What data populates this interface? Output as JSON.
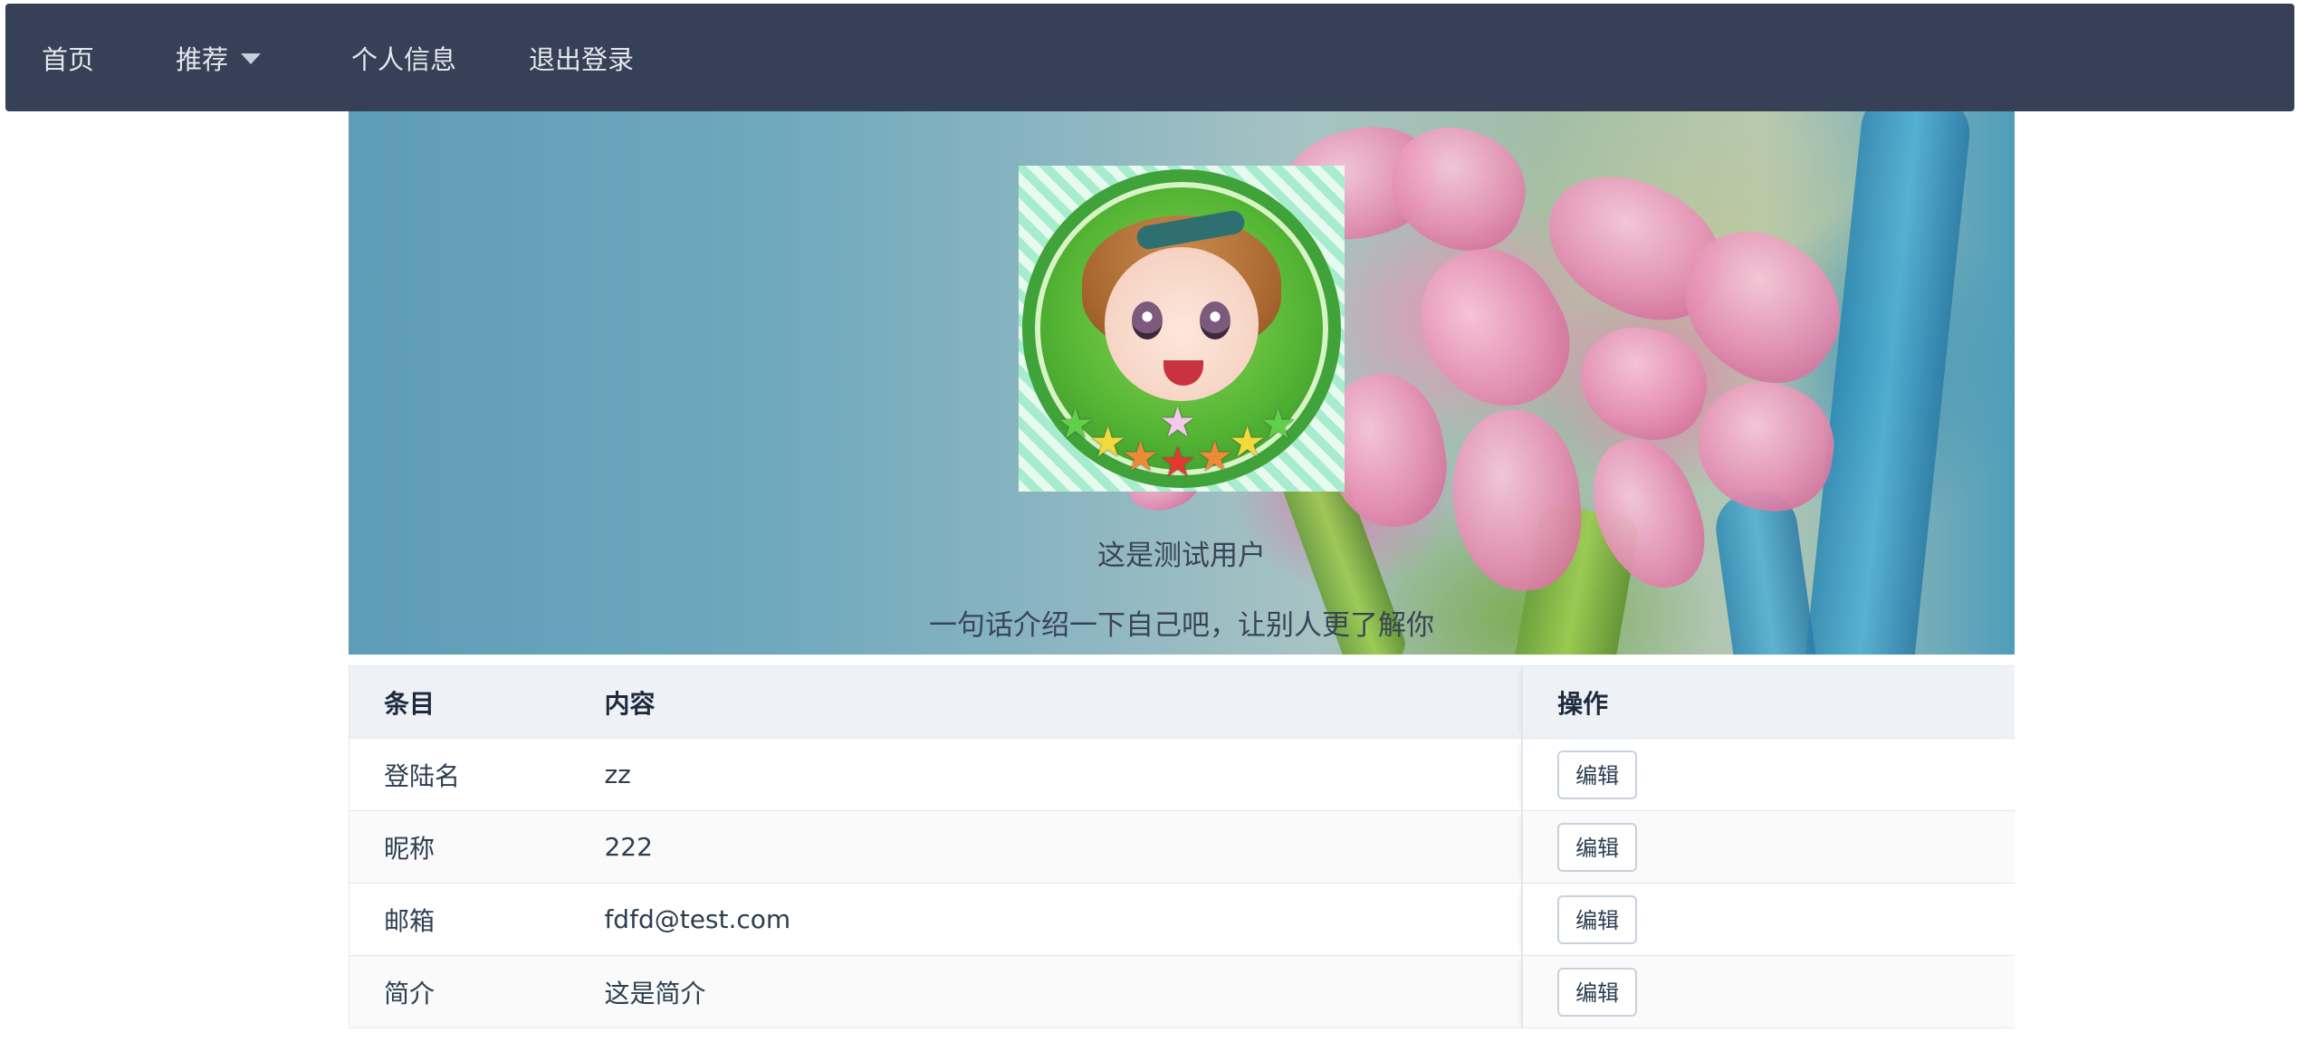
{
  "nav": {
    "home": "首页",
    "recommend": "推荐",
    "profile": "个人信息",
    "logout": "退出登录"
  },
  "banner": {
    "username": "这是测试用户",
    "bio": "一句话介绍一下自己吧，让别人更了解你"
  },
  "table": {
    "headers": {
      "item": "条目",
      "content": "内容",
      "action": "操作"
    },
    "rows": [
      {
        "item": "登陆名",
        "content": "zz",
        "action": "编辑"
      },
      {
        "item": "昵称",
        "content": "222",
        "action": "编辑"
      },
      {
        "item": "邮箱",
        "content": "fdfd@test.com",
        "action": "编辑"
      },
      {
        "item": "简介",
        "content": "这是简介",
        "action": "编辑"
      }
    ]
  },
  "colors": {
    "nav_bg": "#364157",
    "nav_text": "#e3e7ee",
    "table_header_bg": "#eef2f7"
  }
}
